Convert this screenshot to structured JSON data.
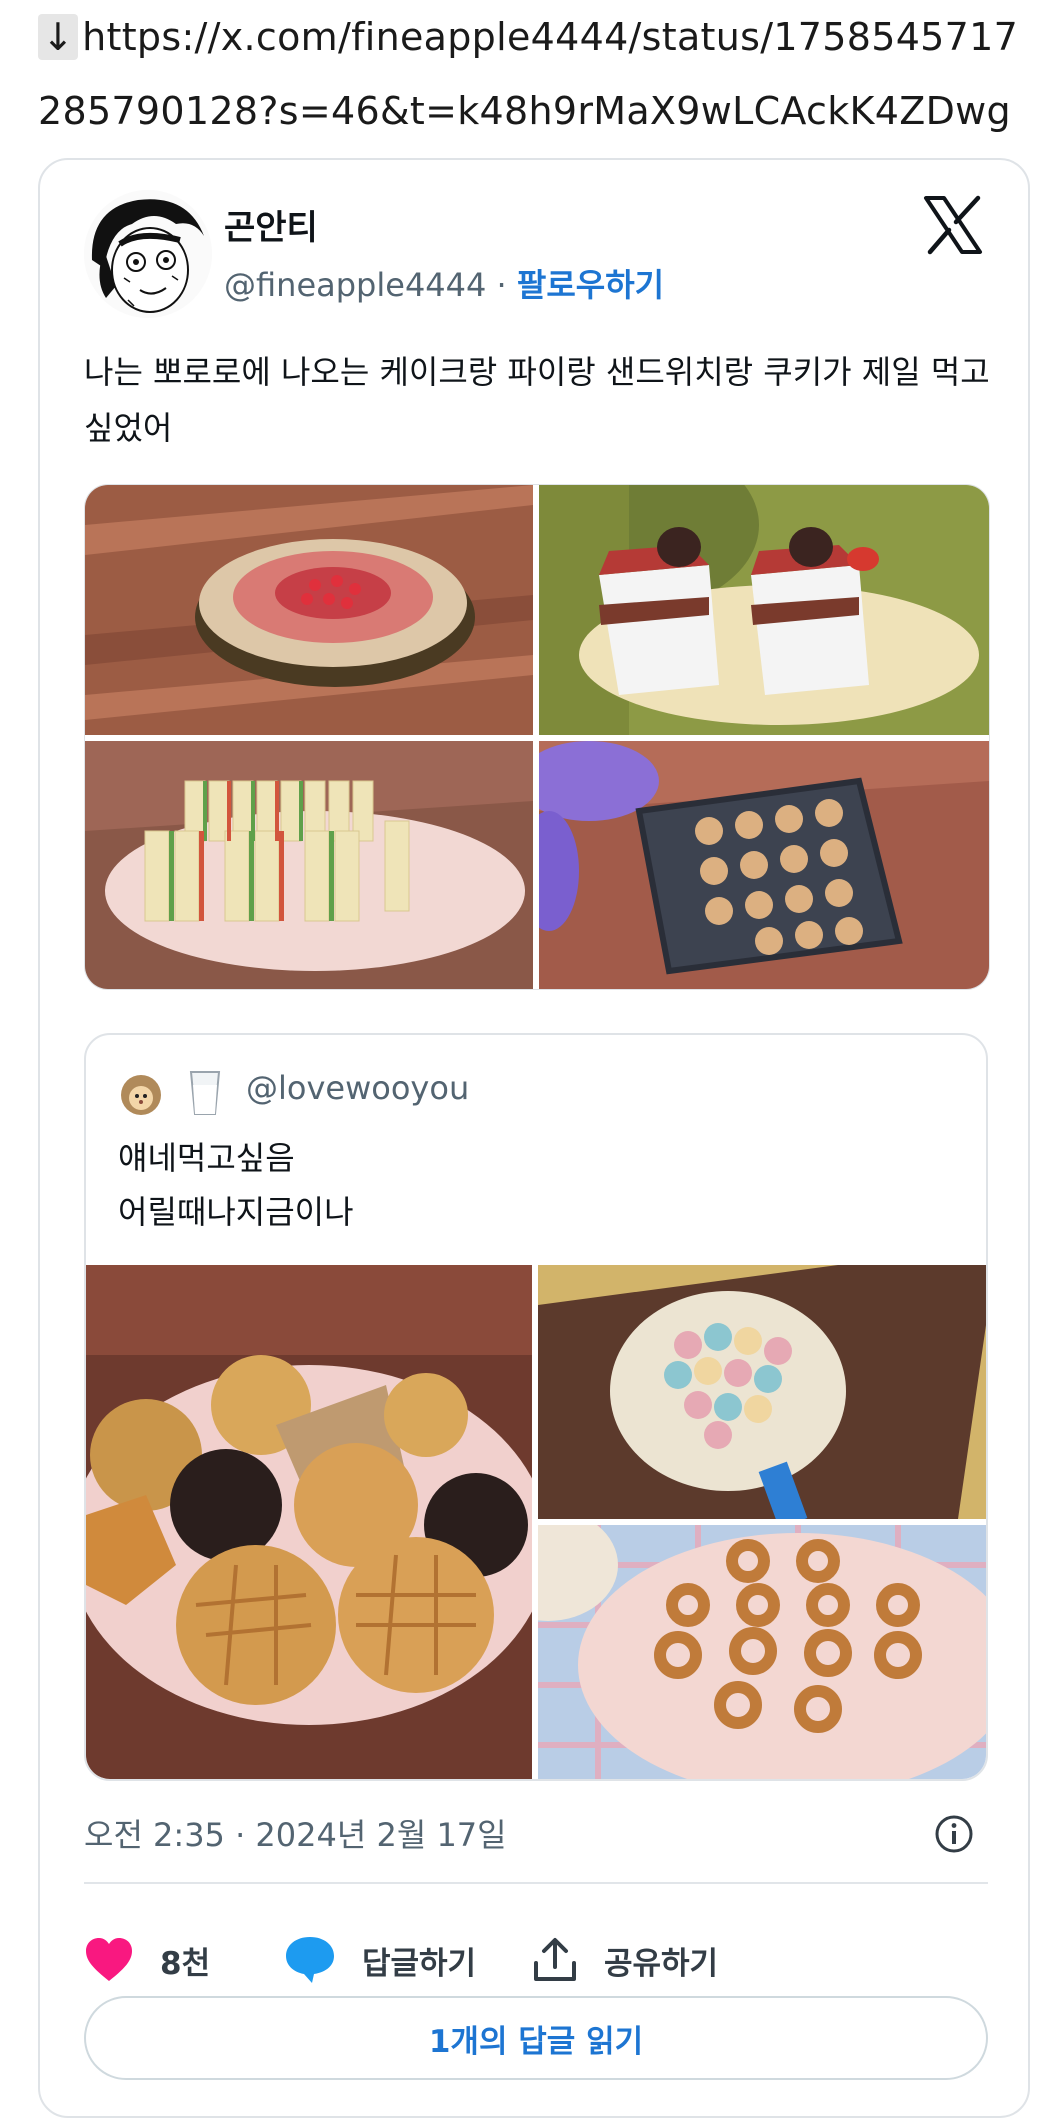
{
  "url": {
    "arrow": "↓",
    "text": "https://x.com/fineapple4444/status/1758545717285790128?s=46&t=k48h9rMaX9wLCAckK4ZDwg"
  },
  "tweet": {
    "author_name": "곤안티",
    "handle": "@fineapple4444",
    "separator": "·",
    "follow_label": "팔로우하기",
    "text": "나는 뽀로로에 나오는 케이크랑 파이랑 샌드위치랑 쿠키가 제일 먹고싶었어",
    "images": [
      {
        "icon": "pie-image"
      },
      {
        "icon": "cake-image"
      },
      {
        "icon": "sandwich-image"
      },
      {
        "icon": "cookie-tray-image"
      }
    ]
  },
  "quote": {
    "avatar_icon": "hedgehog-avatar-icon",
    "glass_icon": "milk-glass-icon",
    "handle": "@lovewooyou",
    "line1": "얘네먹고싶음",
    "line2": "어릴때나지금이나",
    "images": [
      {
        "icon": "cookie-plate-image"
      },
      {
        "icon": "macaron-plate-image"
      },
      {
        "icon": "ring-cookie-plate-image"
      }
    ]
  },
  "footer": {
    "timestamp": "오전 2:35 · 2024년 2월 17일",
    "like_count": "8천",
    "reply_label": "답글하기",
    "share_label": "공유하기",
    "read_replies_label": "1개의 답글 읽기"
  },
  "colors": {
    "accent": "#1d75d2",
    "like": "#f91880",
    "reply": "#1d9bf0",
    "muted": "#536471"
  }
}
